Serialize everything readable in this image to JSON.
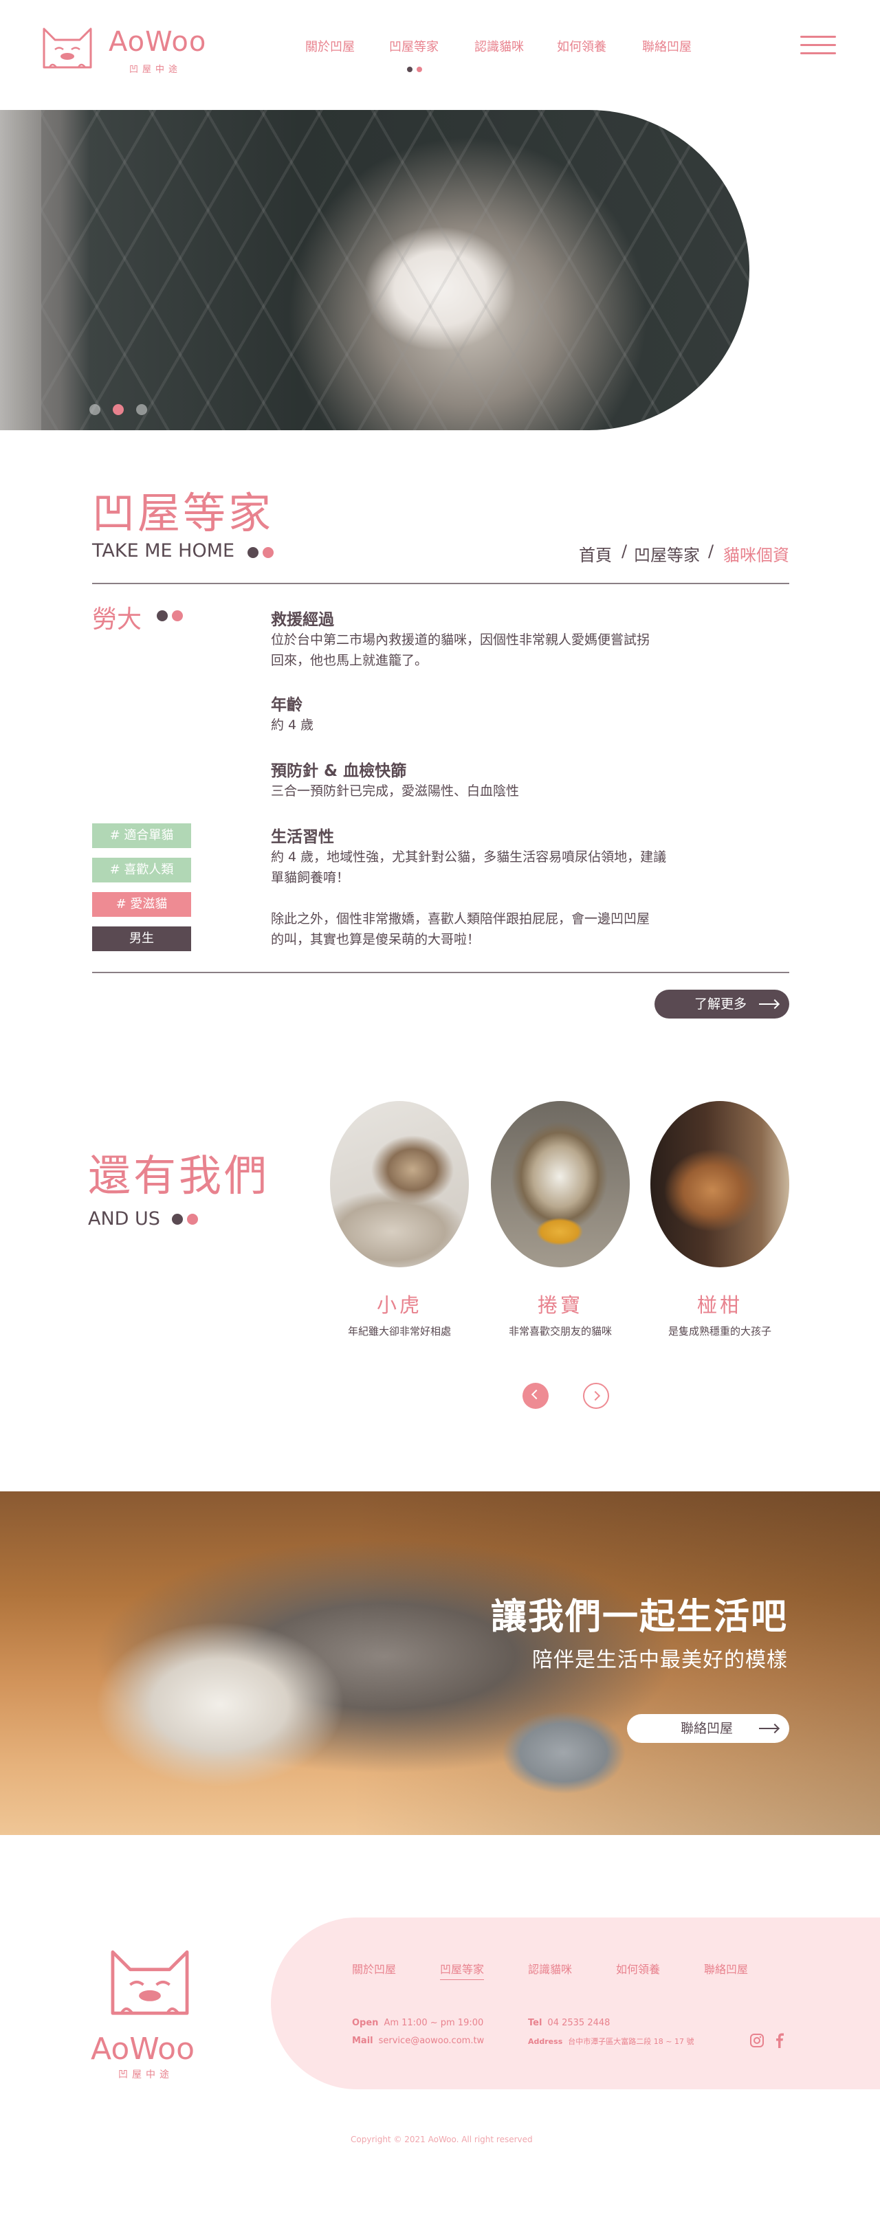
{
  "header": {
    "logo_text": "AoWoo",
    "logo_sub": "凹屋中途",
    "nav": [
      "關於凹屋",
      "凹屋等家",
      "認識貓咪",
      "如何領養",
      "聯絡凹屋"
    ]
  },
  "section": {
    "title": "凹屋等家",
    "subtitle": "TAKE ME HOME",
    "breadcrumb": [
      "首頁",
      "凹屋等家",
      "貓咪個資"
    ],
    "breadcrumb_sep": "/"
  },
  "cat": {
    "name": "勞大",
    "tags": [
      "# 適合單貓",
      "# 喜歡人類",
      "# 愛滋貓",
      "男生"
    ],
    "info": [
      {
        "heading": "救援經過",
        "lines": [
          "位於台中第二市場內救援道的貓咪，因個性非常親人愛媽便嘗試拐",
          "回來，他也馬上就進籠了。"
        ]
      },
      {
        "heading": "年齡",
        "lines": [
          "約 4 歲"
        ]
      },
      {
        "heading": "預防針 & 血檢快篩",
        "lines": [
          "三合一預防針已完成，愛滋陽性、白血陰性"
        ]
      },
      {
        "heading": "生活習性",
        "lines": [
          "約 4 歲，地域性強，尤其針對公貓，多貓生活容易噴尿佔領地，建議",
          "單貓飼養唷！",
          "",
          "除此之外，個性非常撒嬌，喜歡人類陪伴跟拍屁屁，會一邊凹凹屋",
          "的叫，其實也算是傻呆萌的大哥啦！"
        ]
      }
    ],
    "more_label": "了解更多"
  },
  "also": {
    "title": "還有我們",
    "subtitle": "AND US",
    "cats": [
      {
        "name": "小虎",
        "desc": "年紀雖大卻非常好相處"
      },
      {
        "name": "捲寶",
        "desc": "非常喜歡交朋友的貓咪"
      },
      {
        "name": "椪柑",
        "desc": "是隻成熟穩重的大孩子"
      }
    ]
  },
  "banner": {
    "title": "讓我們一起生活吧",
    "subtitle": "陪伴是生活中最美好的模樣",
    "button": "聯絡凹屋"
  },
  "footer": {
    "logo_text": "AoWoo",
    "logo_sub": "凹屋中途",
    "nav": [
      "關於凹屋",
      "凹屋等家",
      "認識貓咪",
      "如何領養",
      "聯絡凹屋"
    ],
    "open_label": "Open",
    "open_value": "Am 11:00 ~ pm 19:00",
    "mail_label": "Mail",
    "mail_value": "service@aowoo.com.tw",
    "tel_label": "Tel",
    "tel_value": "04 2535 2448",
    "address_label": "Address",
    "address_value": "台中市潭子區大富路二段 18 ~ 17 號",
    "copyright": "Copyright © 2021 AoWoo. All right reserved"
  },
  "colors": {
    "accent": "#e8828e",
    "dark": "#5a4a52",
    "green_tag": "#b1d7b5",
    "footer_bg": "#fde5e7"
  },
  "icons": [
    "cat-logo-icon",
    "menu-icon",
    "arrow-right-icon",
    "chevron-left-icon",
    "chevron-right-icon",
    "instagram-icon",
    "facebook-icon"
  ]
}
